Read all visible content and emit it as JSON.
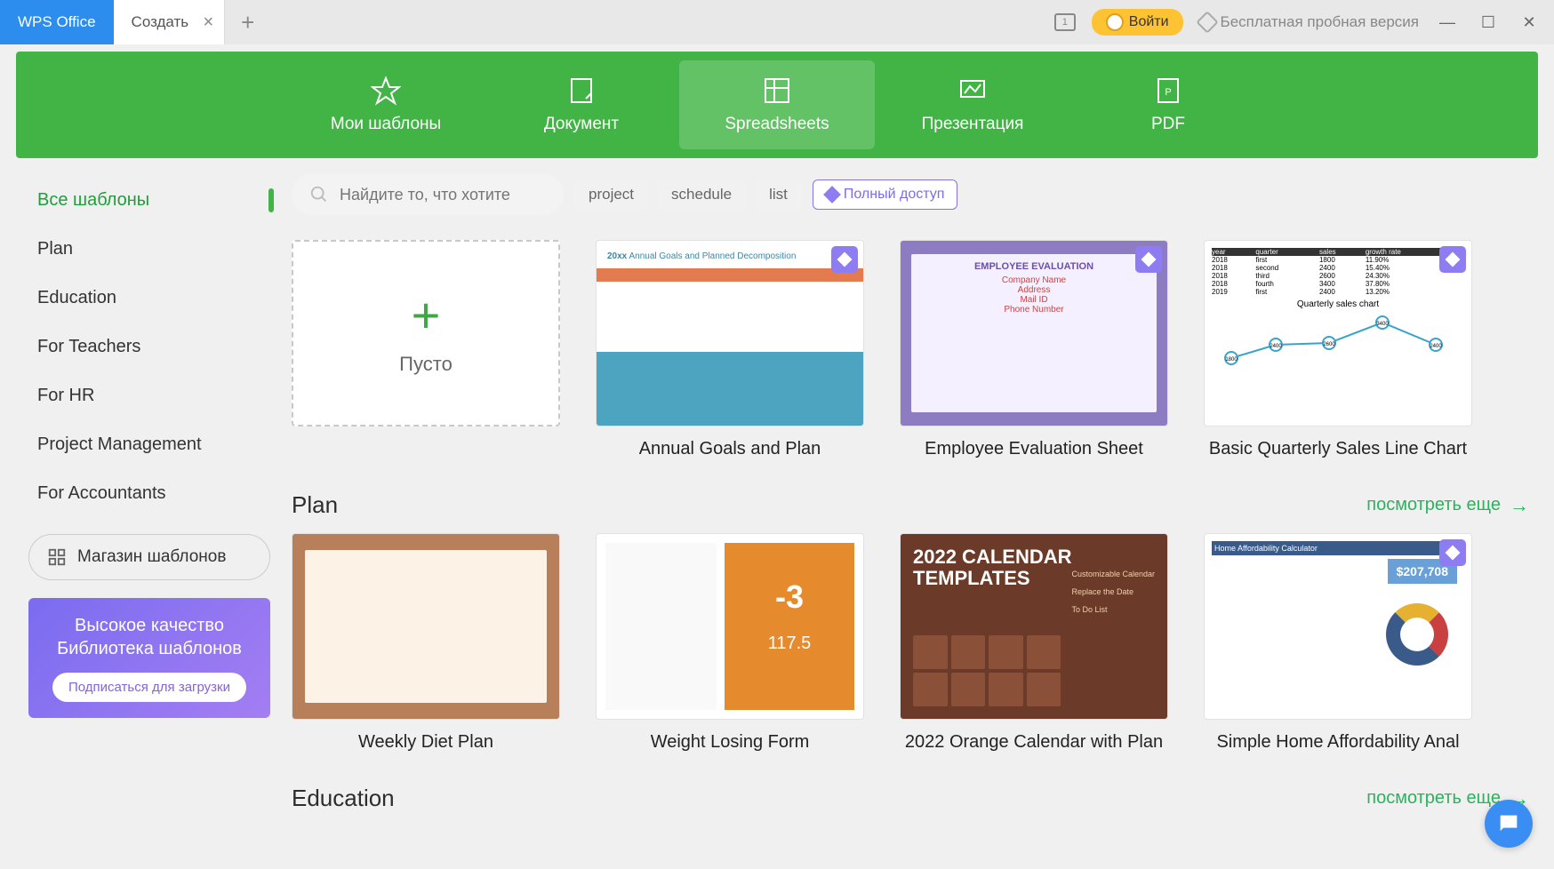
{
  "titlebar": {
    "home_tab": "WPS Office",
    "new_tab": "Создать",
    "login": "Войти",
    "trial": "Бесплатная пробная версия"
  },
  "green_categories": [
    {
      "label": "Мои шаблоны",
      "icon": "star"
    },
    {
      "label": "Документ",
      "icon": "doc"
    },
    {
      "label": "Spreadsheets",
      "icon": "sheet",
      "active": true
    },
    {
      "label": "Презентация",
      "icon": "presentation"
    },
    {
      "label": "PDF",
      "icon": "pdf"
    }
  ],
  "sidebar": {
    "items": [
      {
        "label": "Все шаблоны",
        "active": true
      },
      {
        "label": "Plan"
      },
      {
        "label": "Education"
      },
      {
        "label": "For Teachers"
      },
      {
        "label": "For HR"
      },
      {
        "label": "Project Management"
      },
      {
        "label": "For Accountants"
      }
    ],
    "store": "Магазин шаблонов",
    "promo_title": "Высокое качество Библиотека шаблонов",
    "promo_button": "Подписаться для загрузки"
  },
  "search": {
    "placeholder": "Найдите то, что хотите",
    "chips": [
      "project",
      "schedule",
      "list"
    ],
    "premium": "Полный доступ"
  },
  "empty_card_label": "Пусто",
  "featured": [
    {
      "title": "Annual Goals and Plan",
      "premium": true,
      "style": "t-annual"
    },
    {
      "title": "Employee Evaluation Sheet",
      "premium": true,
      "style": "t-eval"
    },
    {
      "title": "Basic Quarterly Sales Line Chart",
      "premium": true,
      "style": "t-chart"
    }
  ],
  "sections": [
    {
      "title": "Plan",
      "see_more": "посмотреть еще",
      "cards": [
        {
          "title": "Weekly Diet Plan",
          "premium": false,
          "style": "t-diet"
        },
        {
          "title": "Weight Losing Form",
          "premium": false,
          "style": "t-weight"
        },
        {
          "title": "2022 Orange Calendar with Plan",
          "premium": false,
          "style": "t-cal"
        },
        {
          "title": "Simple Home Affordability Anal",
          "premium": true,
          "style": "t-afford"
        }
      ]
    },
    {
      "title": "Education",
      "see_more": "посмотреть еще",
      "cards": []
    }
  ],
  "chart_data": {
    "type": "line",
    "title": "Quarterly sales chart",
    "categories": [
      "first",
      "second",
      "third",
      "fourth",
      "first"
    ],
    "series": [
      {
        "name": "sales 2018",
        "values": [
          1800,
          2400,
          2600,
          3400,
          2400
        ]
      },
      {
        "name": "sales 2019",
        "values": [
          null,
          null,
          null,
          null,
          2400
        ]
      }
    ],
    "growth_rate": [
      "11.90%",
      "15.40%",
      "24.30%",
      "37.80%",
      "13.20%"
    ],
    "ylim": [
      1500,
      3500
    ]
  },
  "calendar_preview": {
    "heading1": "2022 CALENDAR",
    "heading2": "TEMPLATES",
    "lines": [
      "Customizable Calendar",
      "Replace the Date",
      "To Do List"
    ]
  },
  "eval_preview": {
    "title": "EMPLOYEE EVALUATION",
    "fields": [
      "Company Name",
      "Address",
      "Mail ID",
      "Phone Number"
    ]
  },
  "afford_preview": {
    "title": "Home Affordability Calculator",
    "big_value": "$207,708"
  },
  "weight_preview": {
    "big_number": "-3",
    "sub_number": "117.5"
  }
}
